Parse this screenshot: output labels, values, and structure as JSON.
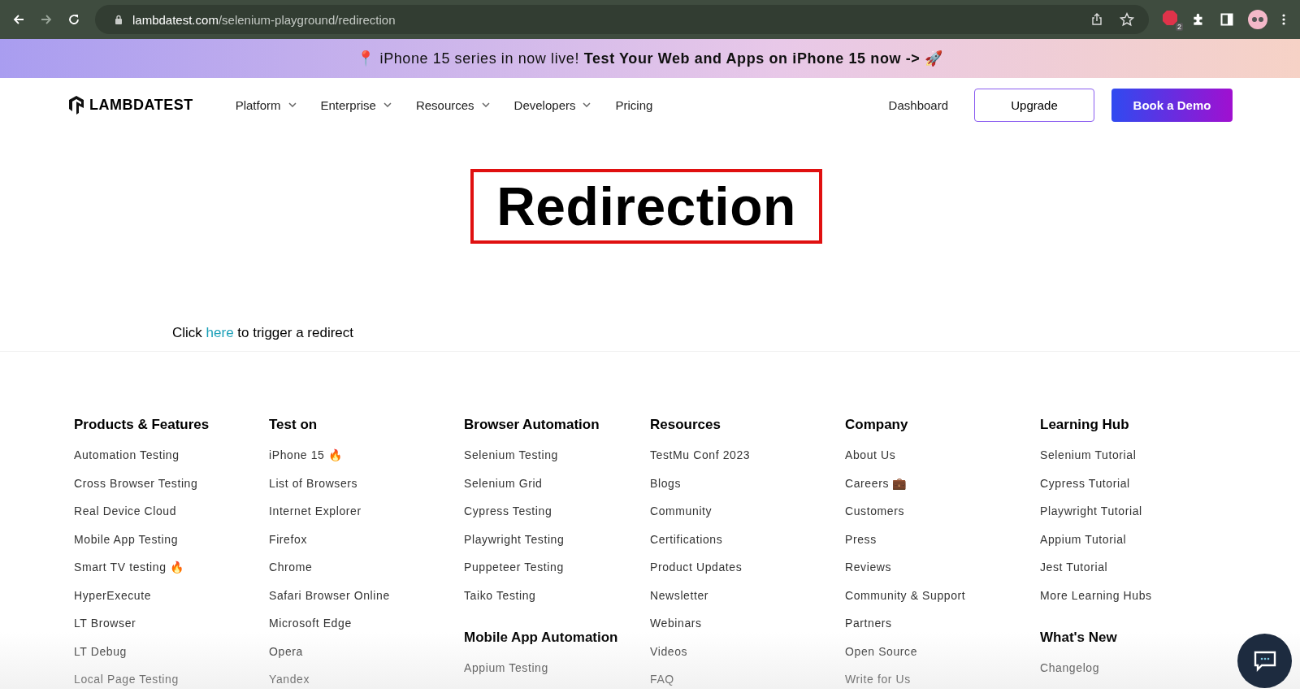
{
  "browser": {
    "url_host": "lambdatest.com",
    "url_path": "/selenium-playground/redirection",
    "extension_badge": "2"
  },
  "banner": {
    "text": "📍 iPhone 15 series in now live! **Test Your Web and Apps on iPhone 15 now ->** 🚀"
  },
  "nav": {
    "logo": "LAMBDATEST",
    "menu": [
      {
        "label": "Platform",
        "dropdown": true
      },
      {
        "label": "Enterprise",
        "dropdown": true
      },
      {
        "label": "Resources",
        "dropdown": true
      },
      {
        "label": "Developers",
        "dropdown": true
      },
      {
        "label": "Pricing",
        "dropdown": false
      }
    ],
    "dashboard": "Dashboard",
    "upgrade": "Upgrade",
    "demo": "Book a Demo"
  },
  "page": {
    "title": "Redirection",
    "before_link": "Click",
    "link": "here",
    "after_link": "to trigger a redirect"
  },
  "footer": [
    {
      "sections": [
        {
          "heading": "Products & Features",
          "links": [
            "Automation Testing",
            "Cross Browser Testing",
            "Real Device Cloud",
            "Mobile App Testing",
            "Smart TV testing 🔥",
            "HyperExecute",
            "LT Browser",
            "LT Debug",
            "Local Page Testing"
          ]
        }
      ]
    },
    {
      "sections": [
        {
          "heading": "Test on",
          "links": [
            "iPhone 15 🔥",
            "List of Browsers",
            "Internet Explorer",
            "Firefox",
            "Chrome",
            "Safari Browser Online",
            "Microsoft Edge",
            "Opera",
            "Yandex"
          ]
        }
      ]
    },
    {
      "sections": [
        {
          "heading": "Browser Automation",
          "links": [
            "Selenium Testing",
            "Selenium Grid",
            "Cypress Testing",
            "Playwright Testing",
            "Puppeteer Testing",
            "Taiko Testing"
          ]
        },
        {
          "heading": "Mobile App Automation",
          "links": [
            "Appium Testing"
          ]
        }
      ]
    },
    {
      "sections": [
        {
          "heading": "Resources",
          "links": [
            "TestMu Conf 2023",
            "Blogs",
            "Community",
            "Certifications",
            "Product Updates",
            "Newsletter",
            "Webinars",
            "Videos",
            "FAQ"
          ]
        }
      ]
    },
    {
      "sections": [
        {
          "heading": "Company",
          "links": [
            "About Us",
            "Careers 💼",
            "Customers",
            "Press",
            "Reviews",
            "Community & Support",
            "Partners",
            "Open Source",
            "Write for Us"
          ]
        }
      ]
    },
    {
      "sections": [
        {
          "heading": "Learning Hub",
          "links": [
            "Selenium Tutorial",
            "Cypress Tutorial",
            "Playwright Tutorial",
            "Appium Tutorial",
            "Jest Tutorial",
            "More Learning Hubs"
          ]
        },
        {
          "heading": "What's New",
          "links": [
            "Changelog"
          ]
        }
      ]
    }
  ]
}
